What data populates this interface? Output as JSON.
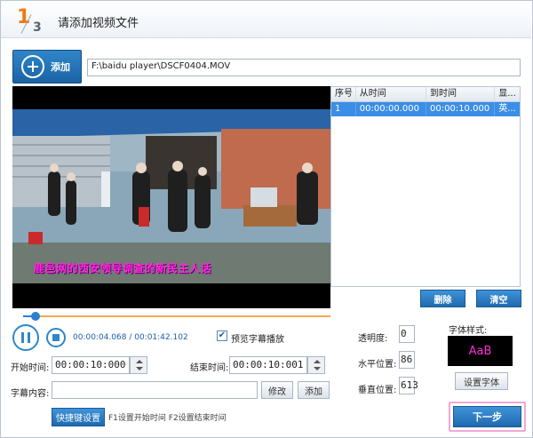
{
  "header": {
    "step_current": "1",
    "step_total": "3",
    "title": "请添加视频文件"
  },
  "file": {
    "add_label": "添加",
    "path": "F:\\baidu player\\DSCF0404.MOV"
  },
  "video": {
    "subtitle_text": "鹿邑网的西安领导调查的新民主人话"
  },
  "subtitle_table": {
    "headers": [
      "序号",
      "从时间",
      "到时间",
      "显..."
    ],
    "rows": [
      {
        "index": "1",
        "from": "00:00:00.000",
        "to": "00:00:10.000",
        "show": "英..."
      }
    ]
  },
  "table_buttons": {
    "delete": "删除",
    "clear": "清空"
  },
  "player": {
    "progress": 0.04,
    "time": "00:00:04.068 / 00:01:42.102",
    "preview_label": "预览字幕播放",
    "preview_checked": true
  },
  "timing": {
    "start_label": "开始时间:",
    "start_value": "00:00:10:000",
    "end_label": "结束时间:",
    "end_value": "00:00:10:001"
  },
  "content": {
    "label": "字幕内容:",
    "value": "",
    "modify": "修改",
    "add": "添加"
  },
  "shortcut": {
    "button": "快捷键设置",
    "hint": "F1设置开始时间  F2设置结束时间"
  },
  "position": {
    "opacity_label": "透明度:",
    "opacity_value": "0",
    "horizontal_label": "水平位置:",
    "horizontal_value": "86",
    "vertical_label": "垂直位置:",
    "vertical_value": "613"
  },
  "font": {
    "label": "字体样式:",
    "preview": "AaB",
    "set_button": "设置字体",
    "preview_color": "#ff2bd9"
  },
  "next": {
    "label": "下一步"
  }
}
